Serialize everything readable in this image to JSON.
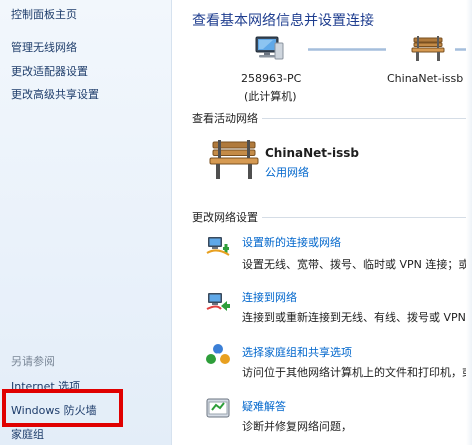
{
  "sidebar": {
    "control_panel_home": "控制面板主页",
    "links": [
      "管理无线网络",
      "更改适配器设置",
      "更改高级共享设置"
    ],
    "see_also_heading": "另请参阅",
    "see_also": [
      "Internet 选项",
      "Windows 防火墙",
      "家庭组"
    ]
  },
  "main": {
    "title": "查看基本网络信息并设置连接",
    "map": {
      "computer_name": "258963-PC",
      "computer_sub": "(此计算机)",
      "network_name": "ChinaNet-issb"
    },
    "active_networks": {
      "heading": "查看活动网络",
      "name": "ChinaNet-issb",
      "type": "公用网络"
    },
    "change_settings": {
      "heading": "更改网络设置",
      "tasks": [
        {
          "link": "设置新的连接或网络",
          "desc": "设置无线、宽带、拨号、临时或 VPN 连接；或",
          "icon": "new-connection-icon"
        },
        {
          "link": "连接到网络",
          "desc": "连接到或重新连接到无线、有线、拨号或 VPN",
          "icon": "connect-network-icon"
        },
        {
          "link": "选择家庭组和共享选项",
          "desc": "访问位于其他网络计算机上的文件和打印机，或",
          "icon": "homegroup-icon"
        },
        {
          "link": "疑难解答",
          "desc": "诊断并修复网络问题，",
          "icon": "troubleshoot-icon"
        }
      ]
    }
  },
  "colors": {
    "link": "#0066cc",
    "title": "#1e3d8f",
    "highlight": "#e00000",
    "sidebar_bg": "#e9f1fa"
  }
}
